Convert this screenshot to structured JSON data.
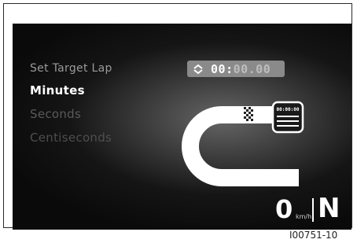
{
  "menu": {
    "title": "Set Target Lap",
    "items": [
      {
        "label": "Minutes"
      },
      {
        "label": "Seconds"
      },
      {
        "label": "Centiseconds"
      }
    ]
  },
  "target_time": {
    "icon": "up-down-arrows-icon",
    "minutes": "00",
    "separator": ":",
    "rest": "00.00"
  },
  "track_widget": {
    "icon": "lap-track-icon",
    "timer_display": "00:00:00"
  },
  "status": {
    "speed": "0",
    "unit": "km/h",
    "gear": "N"
  },
  "figure_code": "I00751-10",
  "colors": {
    "background": "#0a0a0a",
    "active_text": "#ffffff",
    "dim_text": "#5a5a5a",
    "time_box": "#8a8a8a"
  }
}
